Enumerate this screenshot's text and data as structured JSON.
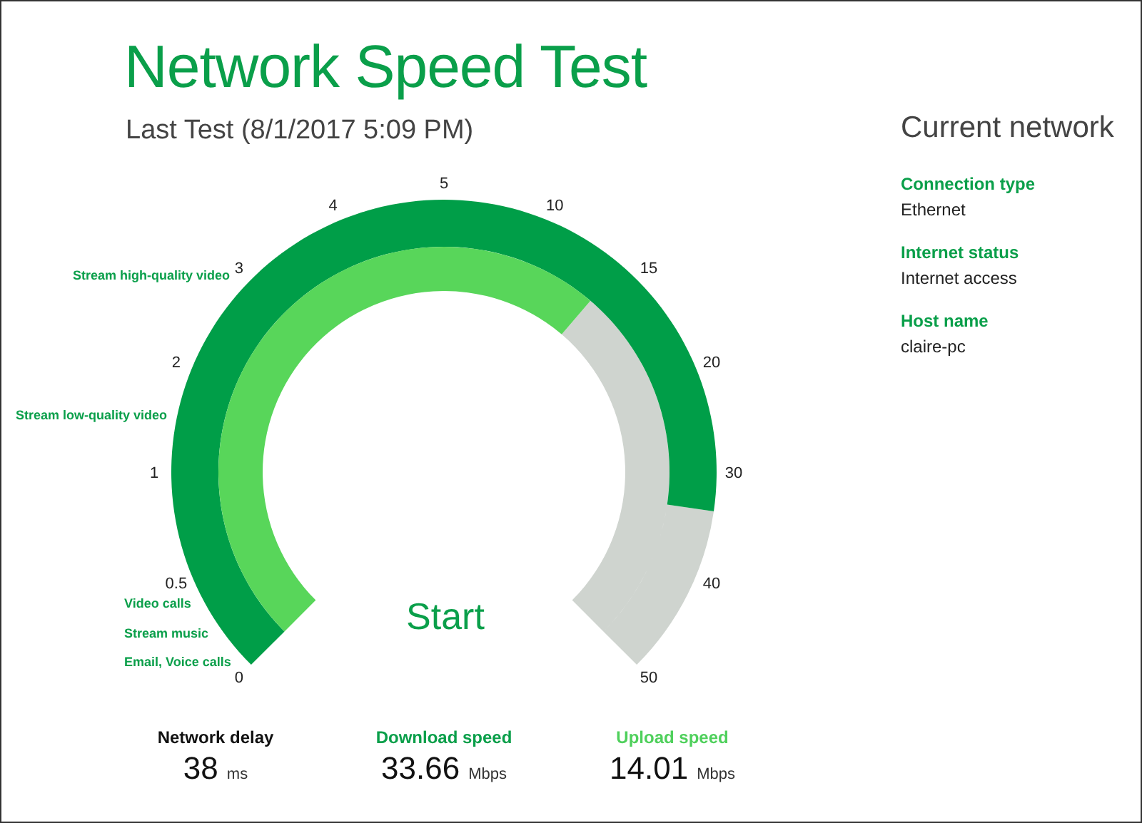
{
  "title": "Network Speed Test",
  "last_test": "Last Test (8/1/2017 5:09 PM)",
  "gauge": {
    "ticks": [
      "0",
      "0.5",
      "1",
      "2",
      "3",
      "4",
      "5",
      "10",
      "15",
      "20",
      "30",
      "40",
      "50"
    ],
    "activities": [
      "Stream high-quality video",
      "Stream low-quality video",
      "Video calls",
      "Stream music",
      "Email, Voice calls"
    ],
    "start_button": "Start"
  },
  "metrics": [
    {
      "kind": "delay",
      "label": "Network delay",
      "value": "38",
      "unit": "ms"
    },
    {
      "kind": "download",
      "label": "Download speed",
      "value": "33.66",
      "unit": "Mbps"
    },
    {
      "kind": "upload",
      "label": "Upload speed",
      "value": "14.01",
      "unit": "Mbps"
    }
  ],
  "current_network": {
    "title": "Current network",
    "fields": [
      {
        "label": "Connection type",
        "value": "Ethernet"
      },
      {
        "label": "Internet status",
        "value": "Internet access"
      },
      {
        "label": "Host name",
        "value": "claire-pc"
      }
    ]
  }
}
